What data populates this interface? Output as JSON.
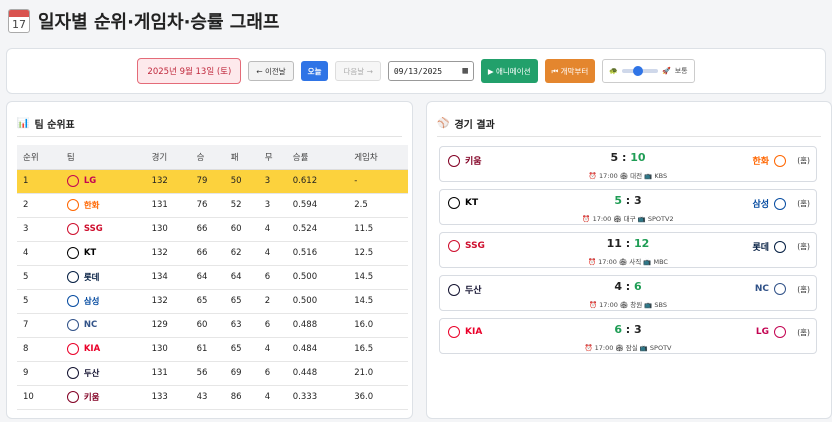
{
  "header": {
    "icon_day": "17",
    "title": "일자별 순위·게임차·승률 그래프"
  },
  "toolbar": {
    "current_date": "2025년 9월 13일 (토)",
    "prev_label": "← 이전날",
    "today_label": "오늘",
    "next_label": "다음날 →",
    "date_value": "09/13/2025",
    "animation_label": "▶ 애니메이션",
    "start_label": "⏮ 개막부터",
    "speed_slow_icon": "🐢",
    "speed_fast_icon": "🚀",
    "speed_label": "보통",
    "speed_level": 0.45
  },
  "standings": {
    "title": "팀 순위표",
    "columns": [
      "순위",
      "팀",
      "경기",
      "승",
      "패",
      "무",
      "승률",
      "게임차"
    ],
    "rows": [
      {
        "rank": "1",
        "team": "LG",
        "color": "#c30452",
        "g": "132",
        "w": "79",
        "l": "50",
        "d": "3",
        "pct": "0.612",
        "gb": "-"
      },
      {
        "rank": "2",
        "team": "한화",
        "color": "#ff6600",
        "g": "131",
        "w": "76",
        "l": "52",
        "d": "3",
        "pct": "0.594",
        "gb": "2.5"
      },
      {
        "rank": "3",
        "team": "SSG",
        "color": "#ce0e2d",
        "g": "130",
        "w": "66",
        "l": "60",
        "d": "4",
        "pct": "0.524",
        "gb": "11.5"
      },
      {
        "rank": "4",
        "team": "KT",
        "color": "#000000",
        "g": "132",
        "w": "66",
        "l": "62",
        "d": "4",
        "pct": "0.516",
        "gb": "12.5"
      },
      {
        "rank": "5",
        "team": "롯데",
        "color": "#041e42",
        "g": "134",
        "w": "64",
        "l": "64",
        "d": "6",
        "pct": "0.500",
        "gb": "14.5"
      },
      {
        "rank": "5",
        "team": "삼성",
        "color": "#074ca1",
        "g": "132",
        "w": "65",
        "l": "65",
        "d": "2",
        "pct": "0.500",
        "gb": "14.5"
      },
      {
        "rank": "7",
        "team": "NC",
        "color": "#315288",
        "g": "129",
        "w": "60",
        "l": "63",
        "d": "6",
        "pct": "0.488",
        "gb": "16.0"
      },
      {
        "rank": "8",
        "team": "KIA",
        "color": "#ea0029",
        "g": "130",
        "w": "61",
        "l": "65",
        "d": "4",
        "pct": "0.484",
        "gb": "16.5"
      },
      {
        "rank": "9",
        "team": "두산",
        "color": "#131230",
        "g": "131",
        "w": "56",
        "l": "69",
        "d": "6",
        "pct": "0.448",
        "gb": "21.0"
      },
      {
        "rank": "10",
        "team": "키움",
        "color": "#820024",
        "g": "133",
        "w": "43",
        "l": "86",
        "d": "4",
        "pct": "0.333",
        "gb": "36.0"
      }
    ]
  },
  "games": {
    "title": "경기 결과",
    "home_tag": "(홈)",
    "items": [
      {
        "away": "키움",
        "away_color": "#820024",
        "away_score": "5",
        "home": "한화",
        "home_color": "#ff6600",
        "home_score": "10",
        "winner": "home",
        "meta": "⏰ 17:00 🏟 대전 📺 KBS"
      },
      {
        "away": "KT",
        "away_color": "#000000",
        "away_score": "5",
        "home": "삼성",
        "home_color": "#074ca1",
        "home_score": "3",
        "winner": "away",
        "meta": "⏰ 17:00 🏟 대구 📺 SPOTV2"
      },
      {
        "away": "SSG",
        "away_color": "#ce0e2d",
        "away_score": "11",
        "home": "롯데",
        "home_color": "#041e42",
        "home_score": "12",
        "winner": "home",
        "meta": "⏰ 17:00 🏟 사직 📺 MBC"
      },
      {
        "away": "두산",
        "away_color": "#131230",
        "away_score": "4",
        "home": "NC",
        "home_color": "#315288",
        "home_score": "6",
        "winner": "home",
        "meta": "⏰ 17:00 🏟 창원 📺 SBS"
      },
      {
        "away": "KIA",
        "away_color": "#ea0029",
        "away_score": "6",
        "home": "LG",
        "home_color": "#c30452",
        "home_score": "3",
        "winner": "away",
        "meta": "⏰ 17:00 🏟 잠실 📺 SPOTV"
      }
    ]
  }
}
